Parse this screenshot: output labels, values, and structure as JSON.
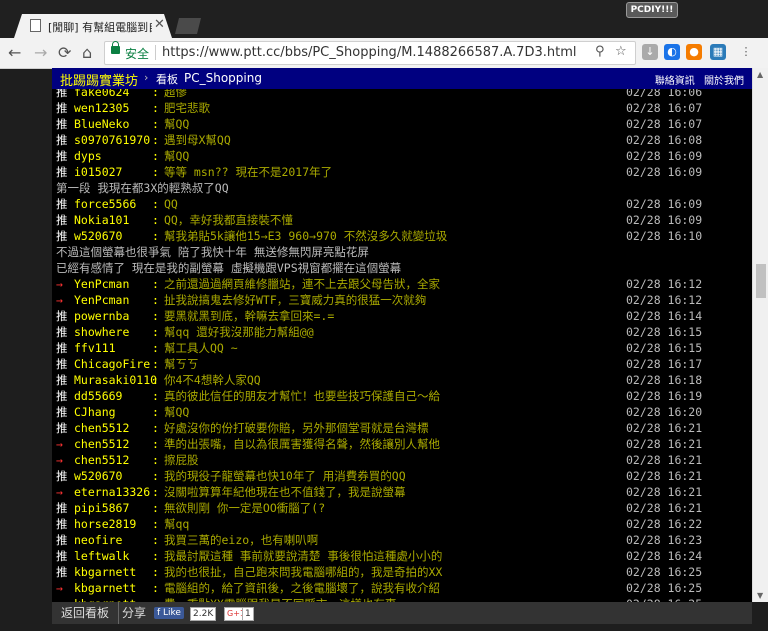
{
  "browser": {
    "tab_title": "[閒聊] 有幫組電腦到自己",
    "tab_close": "✕",
    "badge": "PCDIY!!!",
    "secure_label": "安全",
    "url": "https://www.ptt.cc/bbs/PC_Shopping/M.1488266587.A.7D3.html"
  },
  "header": {
    "brand": "批踢踢實業坊",
    "crumb_sep": "›",
    "crumb_label": "看板",
    "board": "PC_Shopping",
    "contact": "聯絡資訊",
    "about": "關於我們"
  },
  "comments": [
    {
      "tag": "推",
      "user": "fake0624",
      "msg": "超慘",
      "time": "02/28 16:06"
    },
    {
      "tag": "推",
      "user": "wen12305",
      "msg": "肥宅悲歌",
      "time": "02/28 16:07"
    },
    {
      "tag": "推",
      "user": "BlueNeko",
      "msg": "幫QQ",
      "time": "02/28 16:07"
    },
    {
      "tag": "推",
      "user": "s0970761970",
      "msg": "遇到母X幫QQ",
      "time": "02/28 16:08"
    },
    {
      "tag": "推",
      "user": "dyps",
      "msg": "幫QQ",
      "time": "02/28 16:09"
    },
    {
      "tag": "推",
      "user": "i015027",
      "msg": "等等 msn?? 現在不是2017年了",
      "time": "02/28 16:09"
    },
    {
      "line": "第一段 我現在都3X的輕熟叔了QQ"
    },
    {
      "tag": "推",
      "user": "force5566",
      "msg": "QQ",
      "time": "02/28 16:09"
    },
    {
      "tag": "推",
      "user": "Nokia101",
      "msg": "QQ，幸好我都直接裝不懂",
      "time": "02/28 16:09"
    },
    {
      "tag": "推",
      "user": "w520670",
      "msg": "幫我弟貼5k讓他15→E3 960→970 不然沒多久就變垃圾",
      "time": "02/28 16:10"
    },
    {
      "line": "不過這個螢幕也很爭氣 陪了我快十年 無送修無閃屏亮點花屏"
    },
    {
      "line": "已經有感情了 現在是我的副螢幕 虛擬機跟VPS視窗都擺在這個螢幕"
    },
    {
      "tag": "→",
      "user": "YenPcman",
      "msg": "之前還過過網頁維修臘站，連不上去跟父母告狀，全家",
      "time": "02/28 16:12"
    },
    {
      "tag": "→",
      "user": "YenPcman",
      "msg": "扯我說搞鬼去修好WTF，三寶威力真的很猛一次就夠",
      "time": "02/28 16:12"
    },
    {
      "tag": "推",
      "user": "powernba",
      "msg": "要黑就黑到底，幹嘛去拿回來=.=",
      "time": "02/28 16:14"
    },
    {
      "tag": "推",
      "user": "showhere",
      "msg": "幫qq  還好我沒那能力幫組@@",
      "time": "02/28 16:15"
    },
    {
      "tag": "推",
      "user": "ffv111",
      "msg": "幫工具人QQ ~",
      "time": "02/28 16:15"
    },
    {
      "tag": "推",
      "user": "ChicagoFire",
      "msg": "幫ㄎㄎ",
      "time": "02/28 16:17"
    },
    {
      "tag": "推",
      "user": "Murasaki0110",
      "msg": "你4不4想幹人家QQ",
      "time": "02/28 16:18"
    },
    {
      "tag": "推",
      "user": "dd55669",
      "msg": "真的彼此信任的朋友才幫忙！也要些技巧保護自己～給",
      "time": "02/28 16:19"
    },
    {
      "tag": "推",
      "user": "CJhang",
      "msg": "幫QQ",
      "time": "02/28 16:20"
    },
    {
      "tag": "推",
      "user": "chen5512",
      "msg": "好處沒你的份打破要你賠，另外那個堂哥就是台灣標",
      "time": "02/28 16:21"
    },
    {
      "tag": "→",
      "user": "chen5512",
      "msg": "準的出張嘴，自以為很厲害獲得名聲，然後讓別人幫他",
      "time": "02/28 16:21"
    },
    {
      "tag": "→",
      "user": "chen5512",
      "msg": "擦屁股",
      "time": "02/28 16:21"
    },
    {
      "tag": "推",
      "user": "w520670",
      "msg": "我的現役子龍螢幕也快10年了 用消費券買的QQ",
      "time": "02/28 16:21"
    },
    {
      "tag": "→",
      "user": "eterna13326",
      "msg": "沒關啦算算年紀他現在也不值錢了，我是說螢幕",
      "time": "02/28 16:21"
    },
    {
      "tag": "推",
      "user": "pipi5867",
      "msg": "無欲則剛  你一定是OO衝腦了(?",
      "time": "02/28 16:21"
    },
    {
      "tag": "推",
      "user": "horse2819",
      "msg": "幫qq",
      "time": "02/28 16:22"
    },
    {
      "tag": "推",
      "user": "neofire",
      "msg": "我買三萬的eizo，也有喇叭啊",
      "time": "02/28 16:23"
    },
    {
      "tag": "推",
      "user": "leftwalk",
      "msg": "我最討厭這種 事前就要說清楚 事後很怕這種處小小的",
      "time": "02/28 16:24"
    },
    {
      "tag": "推",
      "user": "kbgarnett",
      "msg": "我的也很扯，自己跑來問我電腦哪組的，我是奇拍的XX",
      "time": "02/28 16:25"
    },
    {
      "tag": "→",
      "user": "kbgarnett",
      "msg": "電腦組的，給了資訊後，之後電腦壞了，說我有收介紹",
      "time": "02/28 16:25"
    },
    {
      "tag": "→",
      "user": "kbgarnett",
      "msg": "費，重點XX電腦跟我是不同縣市，這樣也有事⋯",
      "time": "02/28 16:25"
    }
  ],
  "footer": {
    "back": "返回看板",
    "share": "分享",
    "fb_like": "f Like",
    "fb_count": "2.2K",
    "gplus": "G+1",
    "gplus_count": "1"
  }
}
